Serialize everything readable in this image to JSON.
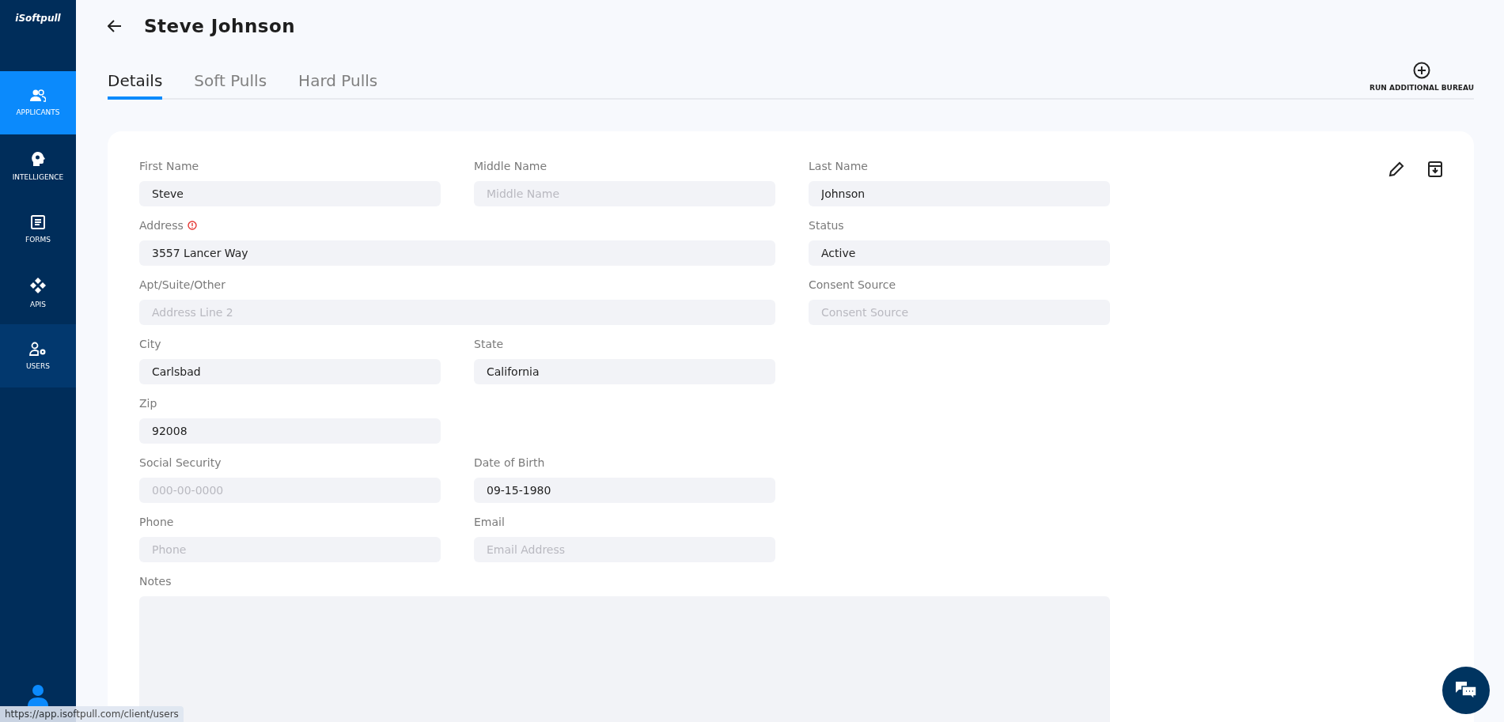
{
  "sidebar": {
    "logo": "iSoftpull",
    "items": [
      {
        "label": "APPLICANTS",
        "selected": true,
        "highlighted": false
      },
      {
        "label": "INTELLIGENCE",
        "selected": false,
        "highlighted": false
      },
      {
        "label": "FORMS",
        "selected": false,
        "highlighted": false
      },
      {
        "label": "APIS",
        "selected": false,
        "highlighted": false
      },
      {
        "label": "USERS",
        "selected": false,
        "highlighted": true
      }
    ]
  },
  "header": {
    "title": "Steve Johnson"
  },
  "tabs": [
    {
      "label": "Details",
      "selected": true
    },
    {
      "label": "Soft Pulls",
      "selected": false
    },
    {
      "label": "Hard Pulls",
      "selected": false
    }
  ],
  "run_button": {
    "label": "RUN ADDITIONAL BUREAU"
  },
  "form": {
    "rows": [
      [
        {
          "kind": "narrow",
          "label": "First Name",
          "value": "Steve",
          "warning": false
        },
        {
          "kind": "narrow",
          "label": "Middle Name",
          "placeholder": "Middle Name",
          "warning": false
        },
        {
          "kind": "narrow",
          "label": "Last Name",
          "value": "Johnson",
          "warning": false
        }
      ],
      [
        {
          "kind": "wide",
          "label": "Address",
          "value": "3557 Lancer Way",
          "warning": true
        },
        {
          "kind": "narrow",
          "label": "Status",
          "value": "Active",
          "warning": false
        }
      ],
      [
        {
          "kind": "wide",
          "label": "Apt/Suite/Other",
          "placeholder": "Address Line 2",
          "warning": false
        },
        {
          "kind": "narrow",
          "label": "Consent Source",
          "placeholder": "Consent Source",
          "warning": false
        }
      ],
      [
        {
          "kind": "narrow",
          "label": "City",
          "value": "Carlsbad",
          "warning": false
        },
        {
          "kind": "narrow",
          "label": "State",
          "value": "California",
          "warning": false
        }
      ],
      [
        {
          "kind": "narrow",
          "label": "Zip",
          "value": "92008",
          "warning": false
        }
      ],
      [
        {
          "kind": "narrow",
          "label": "Social Security",
          "placeholder": "000-00-0000",
          "warning": false
        },
        {
          "kind": "narrow",
          "label": "Date of Birth",
          "value": "09-15-1980",
          "warning": false
        }
      ],
      [
        {
          "kind": "narrow",
          "label": "Phone",
          "placeholder": "Phone",
          "warning": false
        },
        {
          "kind": "narrow",
          "label": "Email",
          "placeholder": "Email Address",
          "warning": false
        }
      ]
    ],
    "notes": {
      "label": "Notes"
    }
  },
  "status_url": "https://app.isoftpull.com/client/users"
}
